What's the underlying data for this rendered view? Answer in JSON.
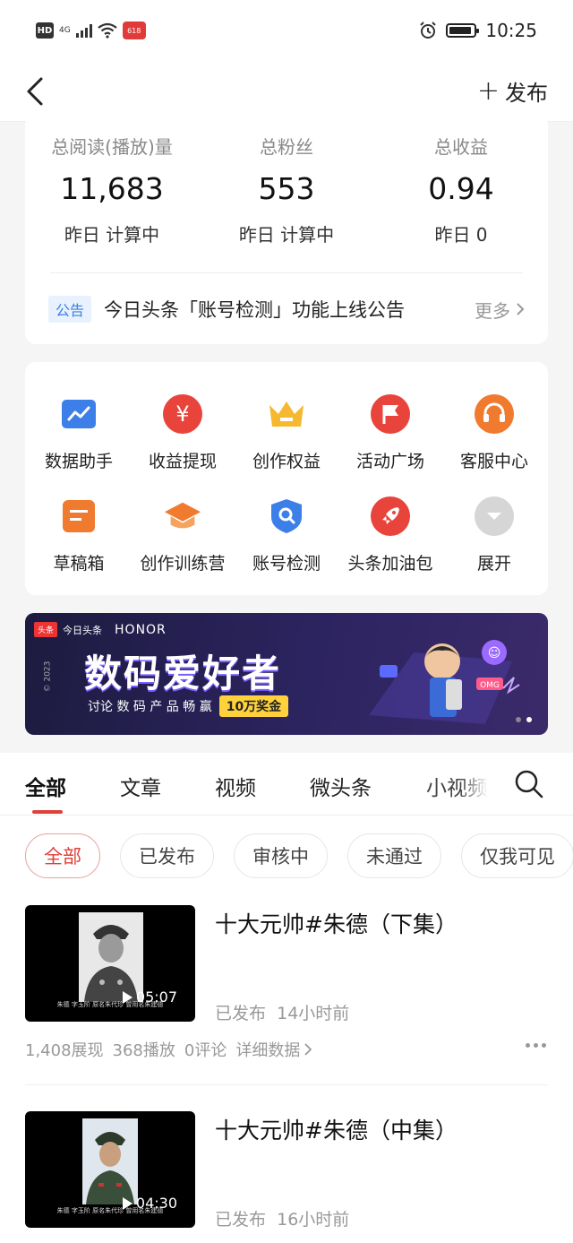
{
  "status_bar": {
    "hd": "HD",
    "network": "4G",
    "badge": "618",
    "time": "10:25"
  },
  "nav": {
    "publish_label": "发布"
  },
  "stats": {
    "items": [
      {
        "label": "总阅读(播放)量",
        "value": "11,683",
        "sub": "昨日 计算中"
      },
      {
        "label": "总粉丝",
        "value": "553",
        "sub": "昨日 计算中"
      },
      {
        "label": "总收益",
        "value": "0.94",
        "sub": "昨日 0"
      }
    ],
    "notice": {
      "tag": "公告",
      "text": "今日头条「账号检测」功能上线公告",
      "more": "更多"
    }
  },
  "tools": {
    "items": [
      {
        "label": "数据助手",
        "icon": "chart-icon",
        "color": "#3d7fe8"
      },
      {
        "label": "收益提现",
        "icon": "yuan-icon",
        "color": "#e8443c"
      },
      {
        "label": "创作权益",
        "icon": "crown-icon",
        "color": "#f5b82e"
      },
      {
        "label": "活动广场",
        "icon": "flag-icon",
        "color": "#e8443c"
      },
      {
        "label": "客服中心",
        "icon": "headset-icon",
        "color": "#f07a2e"
      },
      {
        "label": "草稿箱",
        "icon": "draft-icon",
        "color": "#f07a2e"
      },
      {
        "label": "创作训练营",
        "icon": "graduation-cap-icon",
        "color": "#f07a2e"
      },
      {
        "label": "账号检测",
        "icon": "shield-search-icon",
        "color": "#3d7fe8"
      },
      {
        "label": "头条加油包",
        "icon": "rocket-icon",
        "color": "#e8443c"
      },
      {
        "label": "展开",
        "icon": "chevron-down-icon",
        "color": "#cccccc"
      }
    ]
  },
  "banner": {
    "logo": "头条",
    "brand": "今日头条",
    "partner": "HONOR",
    "title": "数码爱好者",
    "subtitle": "讨论 数 码 产 品  畅 赢",
    "prize": "10万奖金",
    "year": "© 2023"
  },
  "tabs": {
    "items": [
      "全部",
      "文章",
      "视频",
      "微头条",
      "小视频"
    ],
    "active": 0
  },
  "filters": {
    "items": [
      "全部",
      "已发布",
      "审核中",
      "未通过",
      "仅我可见"
    ],
    "active": 0
  },
  "posts": [
    {
      "title": "十大元帅#朱德（下集）",
      "status": "已发布",
      "time": "14小时前",
      "duration": "05:07",
      "caption": "朱德 字玉阶 原名朱代珍 曾用名朱建德",
      "impressions": "1,408展现",
      "plays": "368播放",
      "comments": "0评论",
      "details": "详细数据"
    },
    {
      "title": "十大元帅#朱德（中集）",
      "status": "已发布",
      "time": "16小时前",
      "duration": "04:30",
      "caption": "朱德 字玉阶 原名朱代珍 曾用名朱建德"
    }
  ],
  "colors": {
    "accent": "#e0403a",
    "blue": "#3d7fe8",
    "muted": "#999999"
  }
}
